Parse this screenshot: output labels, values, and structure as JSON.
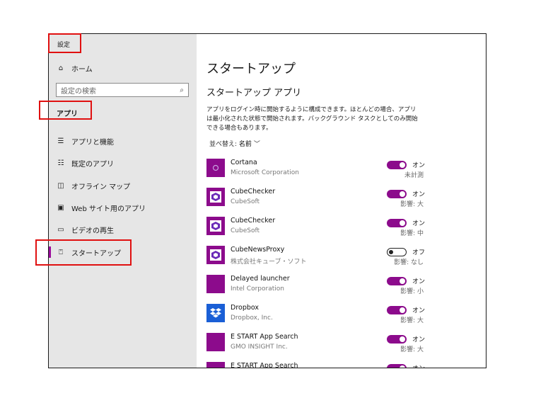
{
  "window": {
    "title": "設定"
  },
  "sidebar": {
    "home_label": "ホーム",
    "search_placeholder": "設定の検索",
    "section_label": "アプリ",
    "items": [
      {
        "label": "アプリと機能",
        "icon": "list-icon"
      },
      {
        "label": "既定のアプリ",
        "icon": "default-apps-icon"
      },
      {
        "label": "オフライン マップ",
        "icon": "map-icon"
      },
      {
        "label": "Web サイト用のアプリ",
        "icon": "website-apps-icon"
      },
      {
        "label": "ビデオの再生",
        "icon": "video-icon"
      },
      {
        "label": "スタートアップ",
        "icon": "startup-icon"
      }
    ]
  },
  "main": {
    "title": "スタートアップ",
    "subtitle": "スタートアップ アプリ",
    "description": "アプリをログイン時に開始するように構成できます。ほとんどの場合、アプリは最小化された状態で開始されます。バックグラウンド タスクとしてのみ開始できる場合もあります。",
    "sort_label": "並べ替え:",
    "sort_value": "名前",
    "apps": [
      {
        "name": "Cortana",
        "publisher": "Microsoft Corporation",
        "state": "オン",
        "on": true,
        "impact": "未計測",
        "icon": "cortana-icon"
      },
      {
        "name": "CubeChecker",
        "publisher": "CubeSoft",
        "state": "オン",
        "on": true,
        "impact": "影響: 大",
        "icon": "cubesoft-icon"
      },
      {
        "name": "CubeChecker",
        "publisher": "CubeSoft",
        "state": "オン",
        "on": true,
        "impact": "影響: 中",
        "icon": "cubesoft-icon"
      },
      {
        "name": "CubeNewsProxy",
        "publisher": "株式会社キューブ・ソフト",
        "state": "オフ",
        "on": false,
        "impact": "影響: なし",
        "icon": "cubesoft-icon"
      },
      {
        "name": "Delayed launcher",
        "publisher": "Intel Corporation",
        "state": "オン",
        "on": true,
        "impact": "影響: 小",
        "icon": "intel-icon"
      },
      {
        "name": "Dropbox",
        "publisher": "Dropbox, Inc.",
        "state": "オン",
        "on": true,
        "impact": "影響: 大",
        "icon": "dropbox-icon"
      },
      {
        "name": "E START App Search",
        "publisher": "GMO INSIGHT Inc.",
        "state": "オン",
        "on": true,
        "impact": "影響: 大",
        "icon": "estart-icon"
      },
      {
        "name": "E START App Search",
        "publisher": "",
        "state": "オン",
        "on": true,
        "impact": "",
        "icon": "estart-icon"
      }
    ]
  },
  "colors": {
    "accent": "#8c0b8c",
    "sidebar_bg": "#e6e6e6",
    "annotation": "#e01010"
  }
}
